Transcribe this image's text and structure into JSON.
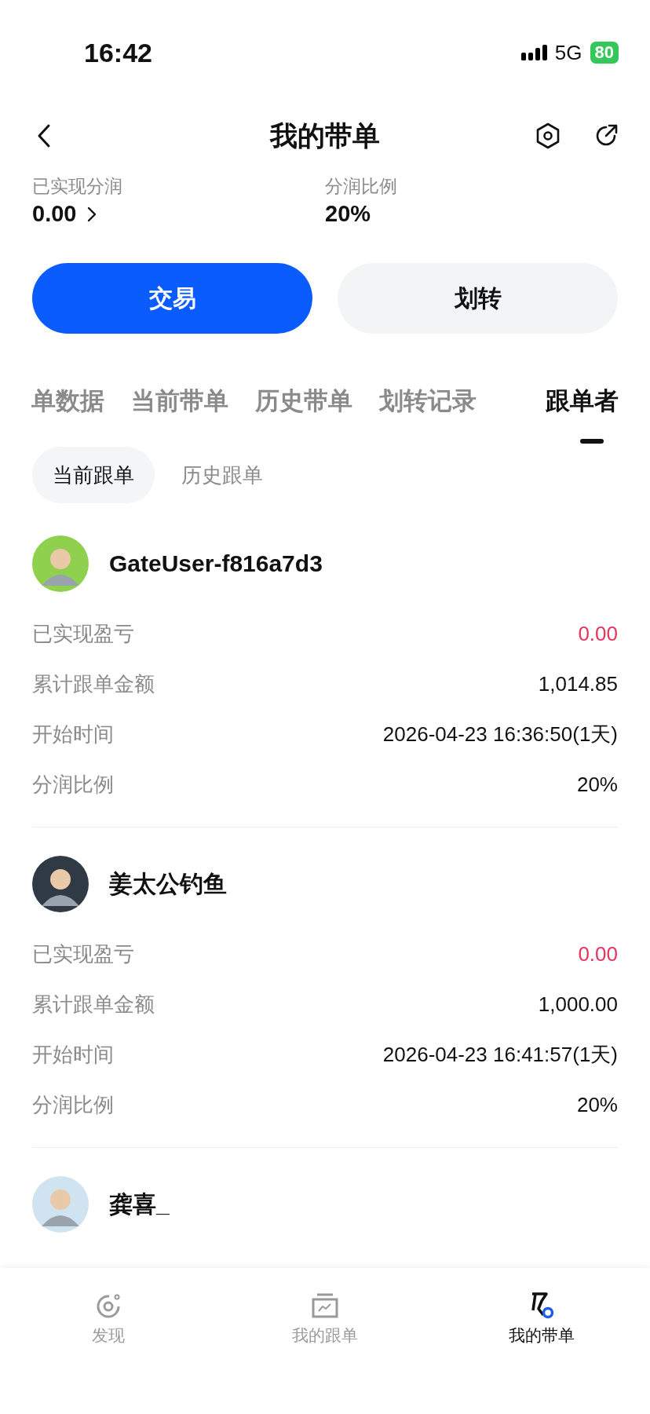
{
  "status_bar": {
    "time": "16:42",
    "network": "5G",
    "battery": "80"
  },
  "header": {
    "title": "我的带单"
  },
  "stats": [
    {
      "label": "已实现分润",
      "value": "0.00",
      "link": true
    },
    {
      "label": "分润比例",
      "value": "20%",
      "link": false
    }
  ],
  "actions": [
    {
      "label": "交易",
      "kind": "primary"
    },
    {
      "label": "划转",
      "kind": "secondary"
    }
  ],
  "tabs": [
    {
      "label": "单数据",
      "selected": false
    },
    {
      "label": "当前带单",
      "selected": false
    },
    {
      "label": "历史带单",
      "selected": false
    },
    {
      "label": "划转记录",
      "selected": false
    },
    {
      "label": "跟单者",
      "selected": true
    }
  ],
  "subtabs": [
    {
      "label": "当前跟单",
      "selected": true
    },
    {
      "label": "历史跟单",
      "selected": false
    }
  ],
  "followers": [
    {
      "name": "GateUser-f816a7d3",
      "rows": [
        {
          "label": "已实现盈亏",
          "value": "0.00",
          "kind": "pnl"
        },
        {
          "label": "累计跟单金额",
          "value": "1,014.85",
          "kind": "plain"
        },
        {
          "label": "开始时间",
          "value": "2026-04-23 16:36:50(1天)",
          "kind": "plain"
        },
        {
          "label": "分润比例",
          "value": "20%",
          "kind": "plain"
        }
      ]
    },
    {
      "name": "姜太公钓鱼",
      "rows": [
        {
          "label": "已实现盈亏",
          "value": "0.00",
          "kind": "pnl"
        },
        {
          "label": "累计跟单金额",
          "value": "1,000.00",
          "kind": "plain"
        },
        {
          "label": "开始时间",
          "value": "2026-04-23 16:41:57(1天)",
          "kind": "plain"
        },
        {
          "label": "分润比例",
          "value": "20%",
          "kind": "plain"
        }
      ]
    },
    {
      "name": "龚喜_"
    }
  ],
  "bottom_nav": [
    {
      "label": "发现",
      "selected": false
    },
    {
      "label": "我的跟单",
      "selected": false
    },
    {
      "label": "我的带单",
      "selected": true
    }
  ]
}
